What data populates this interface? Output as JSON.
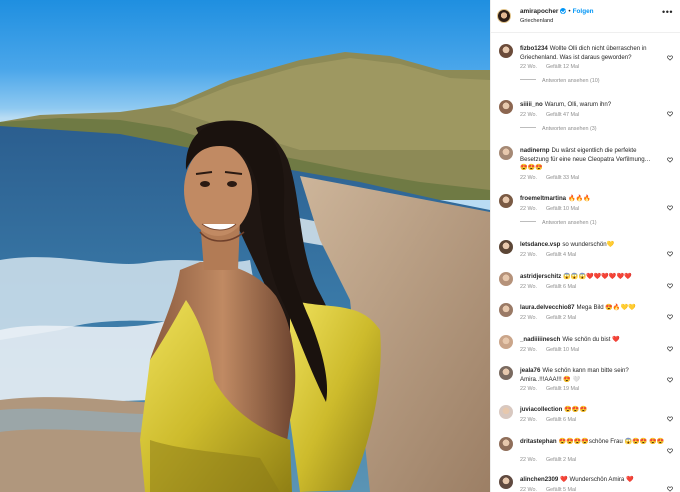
{
  "post": {
    "username": "amirapocher",
    "separator": "•",
    "follow_label": "Folgen",
    "location": "Griechenland",
    "more_icon": "more-horizontal-icon"
  },
  "colors": {
    "accent": "#0095f6",
    "meta": "#8e8e8e",
    "dress": "#d9c83a",
    "sea": "#2d6fa8"
  },
  "comments": [
    {
      "user": "fizbo1234",
      "text": "Wollte Olli dich nicht überraschen in Griechenland. Was ist daraus geworden?",
      "age": "22 Wo.",
      "likes": "Gefällt 12 Mal",
      "replies": "Antworten ansehen (10)"
    },
    {
      "user": "siiiii_no",
      "text": "Warum, Olli, warum ihn?",
      "age": "22 Wo.",
      "likes": "Gefällt 47 Mal",
      "replies": "Antworten ansehen (3)"
    },
    {
      "user": "nadinernp",
      "text": "Du wärst eigentlich die perfekte Besetzung für eine neue Cleopatra Verfilmung…",
      "emoji": "😍😍😍",
      "age": "22 Wo.",
      "likes": "Gefällt 33 Mal"
    },
    {
      "user": "froemeltmartina",
      "text": "🔥🔥🔥",
      "age": "22 Wo.",
      "likes": "Gefällt 10 Mal",
      "replies": "Antworten ansehen (1)"
    },
    {
      "user": "letsdance.vsp",
      "text": "so wunderschön💛",
      "age": "22 Wo.",
      "likes": "Gefällt 4 Mal"
    },
    {
      "user": "astridjerschitz",
      "text": "😱😱😱❤️❤️❤️❤️❤️❤️",
      "age": "22 Wo.",
      "likes": "Gefällt 6 Mal"
    },
    {
      "user": "laura.delvecchio87",
      "text": "Mega Bild 😍🔥💛💛",
      "age": "22 Wo.",
      "likes": "Gefällt 2 Mal"
    },
    {
      "user": "_nadiiiiinesch",
      "text": "Wie schön du bist ❤️",
      "age": "22 Wo.",
      "likes": "Gefällt 10 Mal"
    },
    {
      "user": "jeala76",
      "text": "Wie schön kann man bitte sein? Amira..!!!AAA!!! 😍 🤍",
      "age": "22 Wo.",
      "likes": "Gefällt 19 Mal"
    },
    {
      "user": "juviacollection",
      "text": "😍😍😍",
      "age": "22 Wo.",
      "likes": "Gefällt 6 Mal"
    },
    {
      "user": "dritastephan",
      "text": "😍😍😍😍schöne Frau 😱😍😍 😍😍",
      "age": "22 Wo.",
      "likes": "Gefällt 2 Mal"
    },
    {
      "user": "alinchen2309",
      "text": "❤️ Wunderschön Amira ❤️",
      "age": "22 Wo.",
      "likes": "Gefällt 5 Mal"
    }
  ]
}
